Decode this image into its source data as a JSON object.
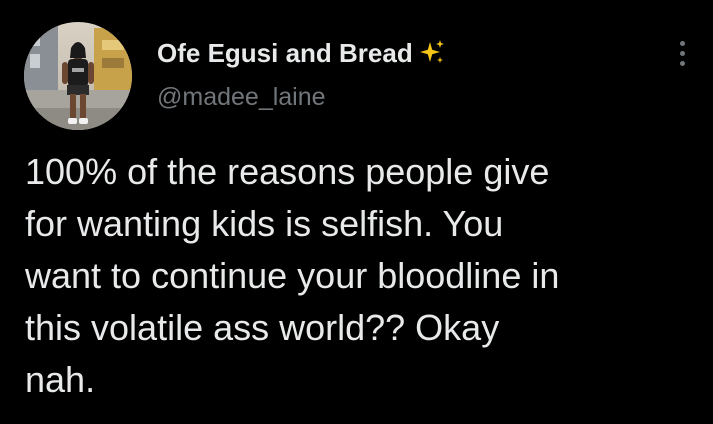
{
  "author": {
    "display_name": "Ofe Egusi and Bread",
    "handle": "@madee_laine",
    "name_emoji_icon": "sparkles-icon",
    "avatar_icon": "profile-photo"
  },
  "menu": {
    "icon": "more-options-icon"
  },
  "tweet": {
    "lines": [
      "100% of the reasons people give",
      "for wanting kids is selfish. You",
      "want to continue your bloodline in",
      "this volatile ass world?? Okay",
      "nah."
    ]
  },
  "colors": {
    "background": "#000000",
    "primary_text": "#e7e9ea",
    "secondary_text": "#71767b",
    "sparkle": "#f5c518"
  }
}
